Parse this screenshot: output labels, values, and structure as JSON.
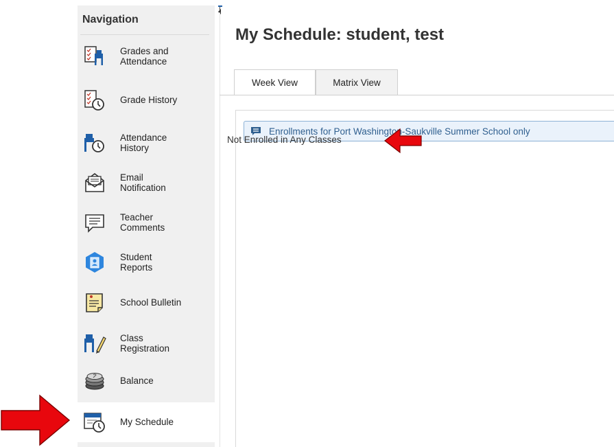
{
  "nav": {
    "title": "Navigation",
    "items": [
      {
        "label": "Grades and\nAttendance",
        "icon": "grades-attendance-icon"
      },
      {
        "label": "Grade History",
        "icon": "grade-history-icon"
      },
      {
        "label": "Attendance\nHistory",
        "icon": "attendance-history-icon"
      },
      {
        "label": "Email\nNotification",
        "icon": "email-icon"
      },
      {
        "label": "Teacher\nComments",
        "icon": "comment-icon"
      },
      {
        "label": "Student\nReports",
        "icon": "student-reports-icon"
      },
      {
        "label": "School Bulletin",
        "icon": "bulletin-icon"
      },
      {
        "label": "Class\nRegistration",
        "icon": "class-registration-icon"
      },
      {
        "label": "Balance",
        "icon": "coins-icon"
      },
      {
        "label": "My Schedule",
        "icon": "schedule-icon"
      }
    ],
    "active_item": "My Schedule"
  },
  "main": {
    "title": "My Schedule: student, test",
    "tabs": [
      {
        "label": "Week View",
        "active": true
      },
      {
        "label": "Matrix View",
        "active": false
      }
    ],
    "banner": "Enrollments for Port Washington-Saukville Summer School only",
    "message": "Not Enrolled in Any Classes"
  },
  "colors": {
    "annotation_arrow": "#e8070d",
    "banner_bg": "#eaf2fb",
    "banner_border": "#8db2d6",
    "banner_text": "#2f5f8f",
    "sidebar_bg": "#f0f0f0"
  }
}
